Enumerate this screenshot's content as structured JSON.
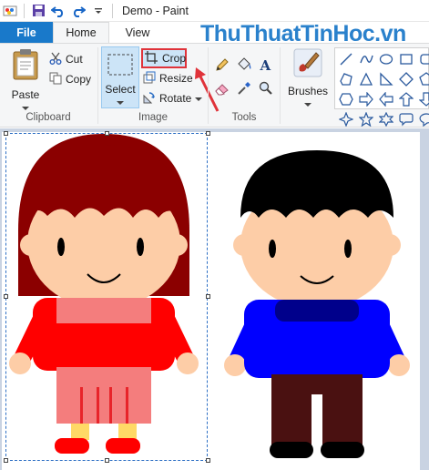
{
  "window": {
    "title": "Demo - Paint",
    "watermark": "ThuThuatTinHoc.vn"
  },
  "tabs": [
    {
      "label": "File"
    },
    {
      "label": "Home"
    },
    {
      "label": "View"
    }
  ],
  "clipboard": {
    "paste_label": "Paste",
    "cut_label": "Cut",
    "copy_label": "Copy",
    "group_label": "Clipboard"
  },
  "image": {
    "select_label": "Select",
    "crop_label": "Crop",
    "resize_label": "Resize",
    "rotate_label": "Rotate",
    "group_label": "Image"
  },
  "tools": {
    "group_label": "Tools",
    "items": [
      "pencil-icon",
      "fill-icon",
      "text-icon",
      "eraser-icon",
      "color-picker-icon",
      "magnifier-icon"
    ]
  },
  "brushes": {
    "label": "Brushes"
  },
  "shapes": {
    "items": [
      "line",
      "curve",
      "oval",
      "rectangle",
      "rounded-rectangle",
      "polygon",
      "triangle",
      "right-triangle",
      "diamond",
      "pentagon",
      "hexagon",
      "right-arrow",
      "left-arrow",
      "up-arrow",
      "down-arrow",
      "four-point-star",
      "five-point-star",
      "six-point-star",
      "rounded-callout",
      "oval-callout"
    ]
  },
  "colors": {
    "accent": "#1979ca",
    "highlight_box": "#e0333a",
    "girl_hair": "#8b0000",
    "girl_shirt": "#ff0000",
    "girl_skirt": "#f47d7d",
    "boy_hair": "#000000",
    "boy_shirt": "#0000ff",
    "boy_pants": "#4a1111",
    "skin": "#fdcda7"
  }
}
